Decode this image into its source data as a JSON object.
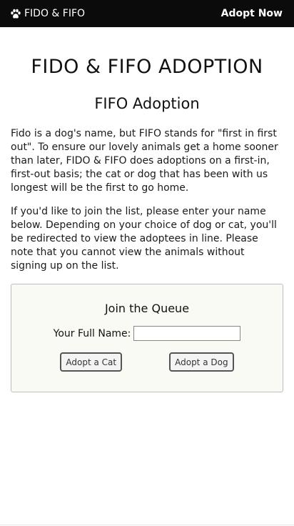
{
  "nav": {
    "brand": "FIDO & FIFO",
    "brand_icon": "paw-icon",
    "adopt_link": "Adopt Now"
  },
  "main": {
    "title": "FIDO & FIFO ADOPTION",
    "subtitle": "FIFO Adoption",
    "paragraph1": "Fido is a dog's name, but FIFO stands for \"first in first out\". To ensure our lovely animals get a home sooner than later, FIDO & FIFO does adoptions on a first-in, first-out basis; the cat or dog that has been with us longest will be the first to go home.",
    "paragraph2": "If you'd like to join the list, please enter your name below. Depending on your choice of dog or cat, you'll be redirected to view the adoptees in line. Please note that you cannot view the animals without signing up on the list."
  },
  "queue": {
    "title": "Join the Queue",
    "name_label": "Your Full Name:",
    "name_value": "",
    "cat_button": "Adopt a Cat",
    "dog_button": "Adopt a Dog"
  }
}
